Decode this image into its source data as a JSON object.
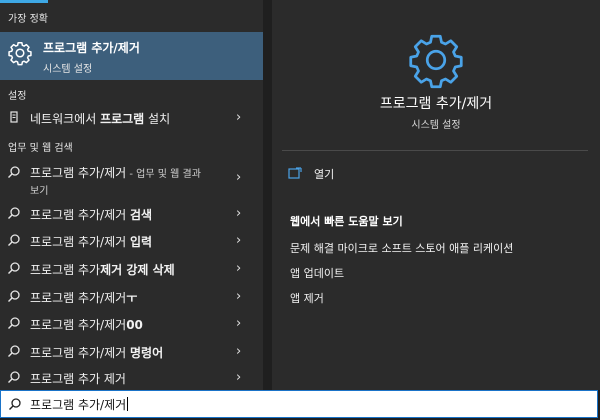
{
  "sections": {
    "best_match": "가장 정확",
    "settings": "설정",
    "web_search": "업무 및 웹 검색"
  },
  "best_match": {
    "title": "프로그램 추가/제거",
    "subtitle": "시스템 설정",
    "icon": "gear-icon"
  },
  "settings_item": {
    "prefix": "네트워크에서 ",
    "bold": "프로그램",
    "suffix": " 설치",
    "icon": "installer-icon"
  },
  "search_results": [
    {
      "normal": "프로그램 추가/제거",
      "bold": "",
      "hint": " - 업무 및 웹 결과",
      "line2": "보기"
    },
    {
      "normal": "프로그램 추가/제거 ",
      "bold": "검색"
    },
    {
      "normal": "프로그램 추가/제거 ",
      "bold": "입력"
    },
    {
      "normal": "프로그램 추가",
      "bold": "제거 강제 삭제"
    },
    {
      "normal": "프로그램 추가/제거",
      "bold": "ㅜ"
    },
    {
      "normal": "프로그램 추가/제거",
      "bold": "00"
    },
    {
      "normal": "프로그램 추가/제거 ",
      "bold": "명령어"
    },
    {
      "normal": "프로그램 추가 제거",
      "bold": ""
    }
  ],
  "detail": {
    "title": "프로그램 추가/제거",
    "subtitle": "시스템 설정",
    "open_label": "열기",
    "web_help_title": "웹에서 빠른 도움말 보기",
    "web_links": [
      "문제 해결 마이크로 소프트 스토어 애플 리케이션",
      "앱 업데이트",
      "앱 제거"
    ]
  },
  "search": {
    "value": "프로그램 추가/제거"
  },
  "colors": {
    "accent": "#3ea8e5",
    "selected_bg": "#3d5f7c",
    "panel_bg": "#2b2b2b"
  }
}
